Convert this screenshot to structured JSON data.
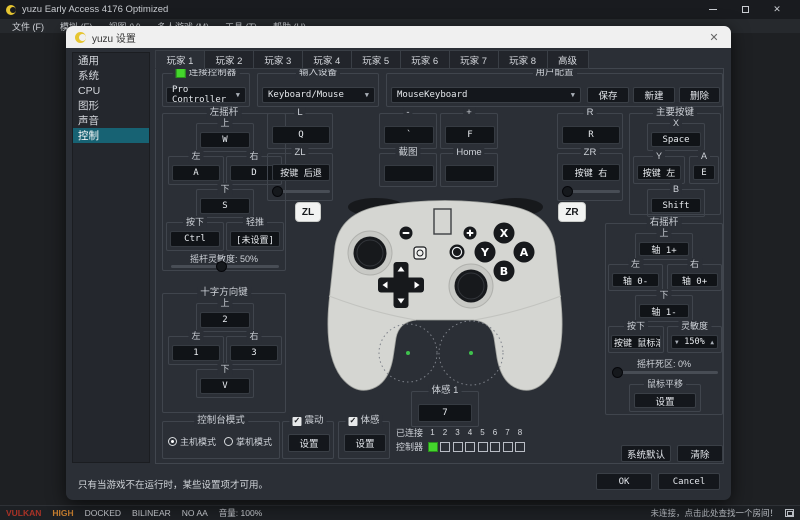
{
  "window": {
    "title": "yuzu Early Access 4176 Optimized",
    "menus": [
      "文件 (F)",
      "模拟 (E)",
      "视图 (V)",
      "多人游戏 (M)",
      "工具 (T)",
      "帮助 (H)"
    ],
    "status": {
      "items": [
        {
          "label": "VULKAN",
          "color": "#a93226"
        },
        {
          "label": "HIGH",
          "color": "#c87f2f"
        },
        {
          "label": "DOCKED",
          "color": "#c9ccd1"
        },
        {
          "label": "BILINEAR",
          "color": "#c9ccd1"
        },
        {
          "label": "NO AA",
          "color": "#c9ccd1"
        },
        {
          "label": "音量: 100%",
          "color": "#c9ccd1"
        }
      ],
      "network": "未连接，点击此处查找一个房间！"
    }
  },
  "dialog": {
    "title": "yuzu 设置",
    "sidebar": {
      "items": [
        "通用",
        "系统",
        "CPU",
        "图形",
        "声音",
        "控制"
      ],
      "active": "控制"
    },
    "tabs": [
      "玩家 1",
      "玩家 2",
      "玩家 3",
      "玩家 4",
      "玩家 5",
      "玩家 6",
      "玩家 7",
      "玩家 8",
      "高级"
    ],
    "top": {
      "connected_checkbox": "连接控制器",
      "controller_type": "Pro Controller",
      "input_device": {
        "title": "输入设备",
        "value": "Keyboard/Mouse"
      },
      "profile": {
        "title": "用户配置",
        "value": "MouseKeyboard",
        "save": "保存",
        "new": "新建",
        "delete": "删除"
      }
    },
    "left_stick": {
      "title": "左摇杆",
      "up": {
        "label": "上",
        "value": "W"
      },
      "left": {
        "label": "左",
        "value": "A"
      },
      "right": {
        "label": "右",
        "value": "D"
      },
      "down": {
        "label": "下",
        "value": "S"
      },
      "pressed": {
        "label": "按下",
        "value": "Ctrl"
      },
      "modifier": {
        "label": "轻推",
        "value": "[未设置]"
      },
      "range": "摇杆灵敏度: 50%"
    },
    "l": {
      "title": "L",
      "value": "Q"
    },
    "zl": {
      "title": "ZL",
      "value": "按键 后退"
    },
    "minus": {
      "title": "-",
      "value": "`"
    },
    "plus": {
      "title": "+",
      "value": "F"
    },
    "capture": {
      "title": "截图",
      "value": ""
    },
    "home": {
      "title": "Home",
      "value": ""
    },
    "r": {
      "title": "R",
      "value": "R"
    },
    "zr": {
      "title": "ZR",
      "value": "按键 右"
    },
    "face": {
      "title": "主要按键",
      "x": {
        "label": "X",
        "value": "Space"
      },
      "y": {
        "label": "Y",
        "value": "按键 左"
      },
      "a": {
        "label": "A",
        "value": "E"
      },
      "b": {
        "label": "B",
        "value": "Shift"
      }
    },
    "dpad": {
      "title": "十字方向键",
      "up": {
        "label": "上",
        "value": "2"
      },
      "left": {
        "label": "左",
        "value": "1"
      },
      "right": {
        "label": "右",
        "value": "3"
      },
      "down": {
        "label": "下",
        "value": "V"
      }
    },
    "right_stick": {
      "title": "右摇杆",
      "up": {
        "label": "上",
        "value": "轴 1+"
      },
      "left": {
        "label": "左",
        "value": "轴 0-"
      },
      "right": {
        "label": "右",
        "value": "轴 0+"
      },
      "down": {
        "label": "下",
        "value": "轴 1-"
      },
      "pressed": {
        "label": "按下",
        "value": "按键 鼠标滚轮"
      },
      "range": {
        "label": "灵敏度",
        "value": "150%"
      },
      "deadzone": "摇杆死区: 0%",
      "mouse_pan": {
        "title": "鼠标平移",
        "button": "设置"
      }
    },
    "motion1": {
      "title": "体感 1",
      "value": "7"
    },
    "console_mode": {
      "title": "控制台模式",
      "options": [
        "主机模式",
        "掌机模式"
      ]
    },
    "vibration": {
      "title": "震动",
      "button": "设置"
    },
    "motion": {
      "title": "体感",
      "button": "设置"
    },
    "connected": {
      "label": "已连接",
      "numbers": [
        "1",
        "2",
        "3",
        "4",
        "5",
        "6",
        "7",
        "8"
      ],
      "controller_label": "控制器"
    },
    "actions": {
      "defaults": "系统默认",
      "clear": "清除"
    },
    "overlay": {
      "zl": "ZL",
      "zr": "ZR"
    },
    "graphic": {
      "x": "X",
      "y": "Y",
      "a": "A",
      "b": "B"
    },
    "footer": {
      "note": "只有当游戏不在运行时，某些设置项才可用。",
      "ok": "OK",
      "cancel": "Cancel"
    }
  }
}
